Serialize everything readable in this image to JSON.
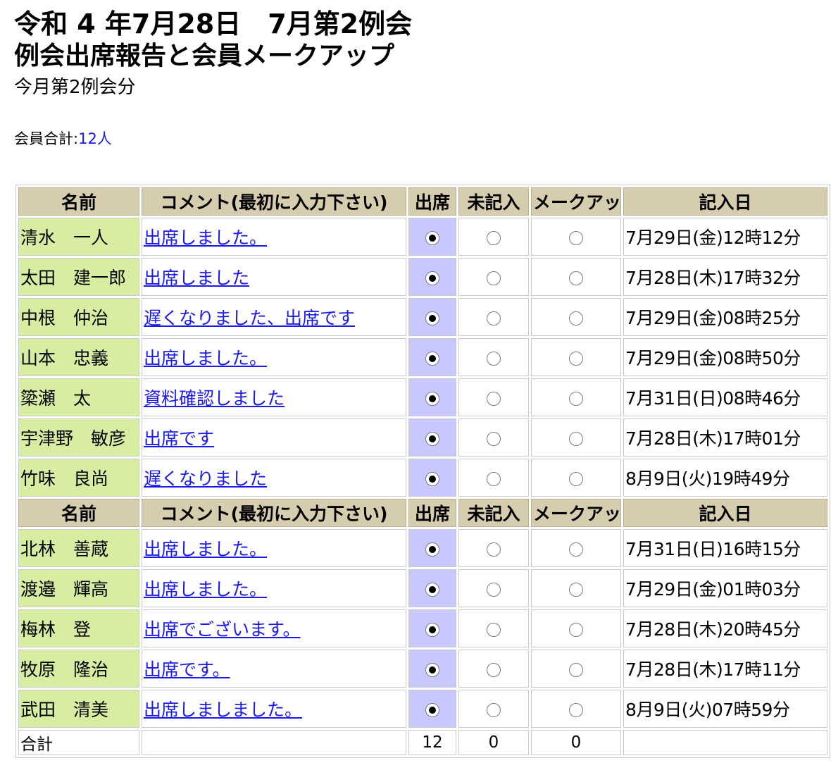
{
  "heading": {
    "line1": "令和 4 年7月28日　7月第2例会",
    "line2": "例会出席報告と会員メークアップ",
    "line3": "今月第2例会分"
  },
  "member_total": {
    "label": "会員合計:",
    "value": "12人"
  },
  "table": {
    "headers": {
      "name": "名前",
      "comment": "コメント(最初に入力下さい)",
      "attend": "出席",
      "unrecorded": "未記入",
      "makeup": "メークアップ",
      "date": "記入日"
    },
    "rows": [
      {
        "name": "清水　一人",
        "comment": "出席しました。",
        "date": "7月29日(金)12時12分"
      },
      {
        "name": "太田　建一郎",
        "comment": "出席しました",
        "date": "7月28日(木)17時32分"
      },
      {
        "name": "中根　仲治",
        "comment": "遅くなりました、出席です",
        "date": "7月29日(金)08時25分"
      },
      {
        "name": "山本　忠義",
        "comment": "出席しました。",
        "date": "7月29日(金)08時50分"
      },
      {
        "name": "簗瀬　太",
        "comment": "資料確認しました",
        "date": "7月31日(日)08時46分"
      },
      {
        "name": "宇津野　敏彦",
        "comment": "出席です",
        "date": "7月28日(木)17時01分"
      },
      {
        "name": "竹味　良尚",
        "comment": "遅くなりました",
        "date": "8月9日(火)19時49分"
      },
      {
        "name": "北林　善蔵",
        "comment": "出席しました。",
        "date": "7月31日(日)16時15分"
      },
      {
        "name": "渡邉　輝高",
        "comment": "出席しました。",
        "date": "7月29日(金)01時03分"
      },
      {
        "name": "梅林　登",
        "comment": "出席でございます。",
        "date": "7月28日(木)20時45分"
      },
      {
        "name": "牧原　隆治",
        "comment": "出席です。",
        "date": "7月28日(木)17時11分"
      },
      {
        "name": "武田　清美",
        "comment": "出席しましました。",
        "date": "8月9日(火)07時59分"
      }
    ],
    "selected_option": "attend",
    "summary": {
      "label": "合計",
      "comment": "",
      "attend": "12",
      "unrecorded": "0",
      "makeup": "0",
      "date": ""
    }
  },
  "colors": {
    "header_bg": "#d6ccae",
    "name_bg": "#d7eea2",
    "attend_bg": "#c8c8ff",
    "link": "#1a1aee"
  }
}
